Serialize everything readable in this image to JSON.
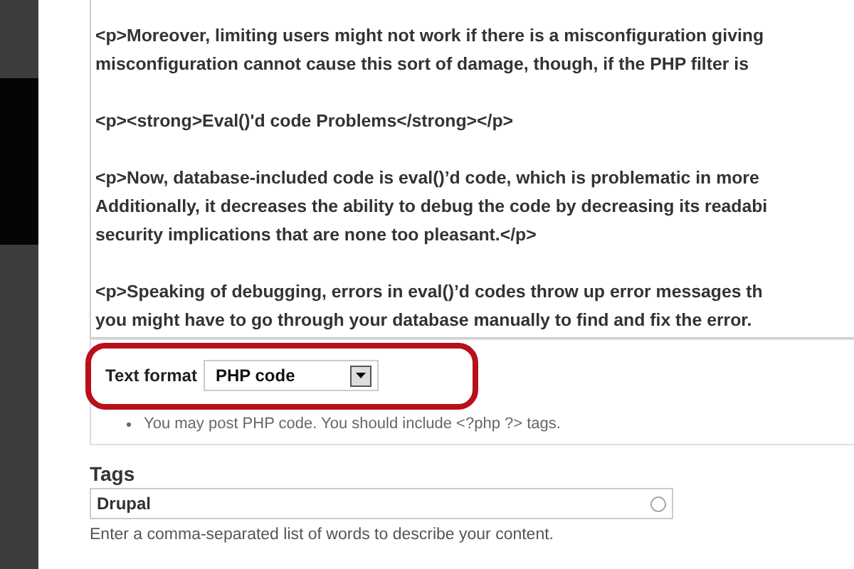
{
  "body_editor": {
    "paragraphs": [
      [
        "<p>Moreover, limiting users might not work if there is a misconfiguration giving",
        "misconfiguration cannot cause this sort of damage, though, if the PHP filter is"
      ],
      [
        "<p><strong>Eval()'d code Problems</strong></p>"
      ],
      [
        "<p>Now, database-included code is eval()’d code, which is problematic in more",
        "Additionally, it decreases the ability to debug the code by decreasing its readabi",
        "security implications that are none too pleasant.</p>"
      ],
      [
        "<p>Speaking of debugging, errors in eval()’d codes throw up error messages th",
        "you might have to go through your database manually to find and fix the error."
      ]
    ]
  },
  "text_format": {
    "label": "Text format",
    "value": "PHP code",
    "tips": [
      "You may post PHP code. You should include <?php ?> tags."
    ],
    "highlighted": true
  },
  "tags": {
    "label": "Tags",
    "value": "Drupal",
    "description": "Enter a comma-separated list of words to describe your content."
  }
}
